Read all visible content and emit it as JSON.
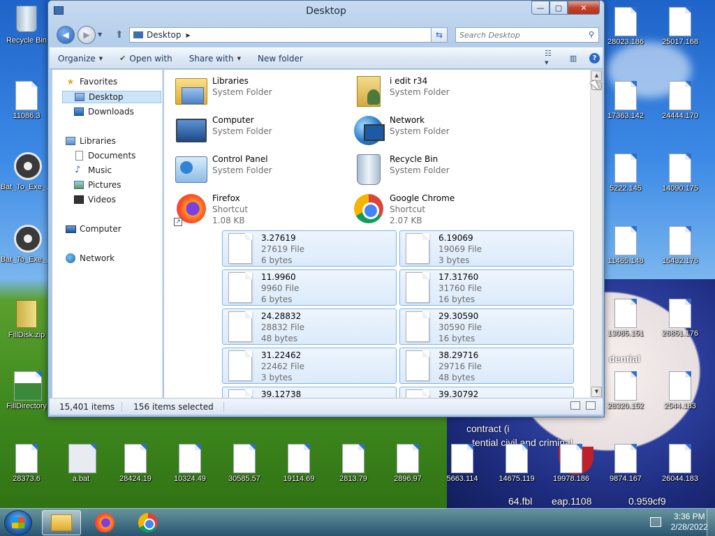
{
  "window": {
    "title": "Desktop",
    "caption_min": "—",
    "caption_max": "▢",
    "caption_close": "✕"
  },
  "navbar": {
    "address": "Desktop",
    "search_placeholder": "Search Desktop"
  },
  "toolbar": {
    "organize": "Organize",
    "open_with": "Open with",
    "share_with": "Share with",
    "new_folder": "New folder"
  },
  "navpane": {
    "favorites": "Favorites",
    "desktop": "Desktop",
    "downloads": "Downloads",
    "libraries": "Libraries",
    "documents": "Documents",
    "music": "Music",
    "pictures": "Pictures",
    "videos": "Videos",
    "computer": "Computer",
    "network": "Network"
  },
  "items": [
    {
      "name": "Libraries",
      "line2": "System Folder",
      "line3": "",
      "icon": "libraries-icon",
      "selected": false
    },
    {
      "name": "i edit r34",
      "line2": "System Folder",
      "line3": "",
      "icon": "user-folder-icon",
      "selected": false
    },
    {
      "name": "Computer",
      "line2": "System Folder",
      "line3": "",
      "icon": "computer-icon",
      "selected": false
    },
    {
      "name": "Network",
      "line2": "System Folder",
      "line3": "",
      "icon": "network-icon",
      "selected": false
    },
    {
      "name": "Control Panel",
      "line2": "System Folder",
      "line3": "",
      "icon": "control-panel-icon",
      "selected": false
    },
    {
      "name": "Recycle Bin",
      "line2": "System Folder",
      "line3": "",
      "icon": "recycle-bin-icon",
      "selected": false
    },
    {
      "name": "Firefox",
      "line2": "Shortcut",
      "line3": "1.08 KB",
      "icon": "firefox-icon",
      "selected": false
    },
    {
      "name": "Google Chrome",
      "line2": "Shortcut",
      "line3": "2.07 KB",
      "icon": "chrome-icon",
      "selected": false
    },
    {
      "name": "3.27619",
      "line2": "27619 File",
      "line3": "6 bytes",
      "icon": "file-icon",
      "selected": true
    },
    {
      "name": "6.19069",
      "line2": "19069 File",
      "line3": "3 bytes",
      "icon": "file-icon",
      "selected": true
    },
    {
      "name": "11.9960",
      "line2": "9960 File",
      "line3": "6 bytes",
      "icon": "file-icon",
      "selected": true
    },
    {
      "name": "17.31760",
      "line2": "31760 File",
      "line3": "16 bytes",
      "icon": "file-icon",
      "selected": true
    },
    {
      "name": "24.28832",
      "line2": "28832 File",
      "line3": "48 bytes",
      "icon": "file-icon",
      "selected": true
    },
    {
      "name": "29.30590",
      "line2": "30590 File",
      "line3": "16 bytes",
      "icon": "file-icon",
      "selected": true
    },
    {
      "name": "31.22462",
      "line2": "22462 File",
      "line3": "3 bytes",
      "icon": "file-icon",
      "selected": true
    },
    {
      "name": "38.29716",
      "line2": "29716 File",
      "line3": "48 bytes",
      "icon": "file-icon",
      "selected": true
    },
    {
      "name": "39.12738",
      "line2": "",
      "line3": "",
      "icon": "file-icon",
      "selected": true
    },
    {
      "name": "39.30792",
      "line2": "",
      "line3": "",
      "icon": "file-icon",
      "selected": true
    }
  ],
  "status": {
    "count": "15,401 items",
    "selected": "156 items selected"
  },
  "desktop_icons": [
    {
      "label": "Recycle Bin",
      "type": "bin"
    },
    {
      "label": "11086.3",
      "type": "doc"
    },
    {
      "label": "Bat_To_Exe_...",
      "type": "gear"
    },
    {
      "label": "Bat_To_Exe_...",
      "type": "gear"
    },
    {
      "label": "FillDisk.zip",
      "type": "zip"
    },
    {
      "label": "FillDirectory",
      "type": "app"
    },
    {
      "label": "28023.186",
      "type": "doc"
    },
    {
      "label": "25017.168",
      "type": "doc"
    },
    {
      "label": "17363.142",
      "type": "doc"
    },
    {
      "label": "24444.170",
      "type": "doc"
    },
    {
      "label": "5222.145",
      "type": "doc"
    },
    {
      "label": "14090.175",
      "type": "doc"
    },
    {
      "label": "11465.148",
      "type": "doc"
    },
    {
      "label": "15432.176",
      "type": "doc"
    },
    {
      "label": "13085.151",
      "type": "doc"
    },
    {
      "label": "26851.176",
      "type": "doc"
    },
    {
      "label": "28320.152",
      "type": "doc"
    },
    {
      "label": "2544.183",
      "type": "doc"
    },
    {
      "label": "28373.6",
      "type": "doc"
    },
    {
      "label": "a.bat",
      "type": "bat"
    },
    {
      "label": "28424.19",
      "type": "doc"
    },
    {
      "label": "10324.49",
      "type": "doc"
    },
    {
      "label": "30585.57",
      "type": "doc"
    },
    {
      "label": "19114.69",
      "type": "doc"
    },
    {
      "label": "2813.79",
      "type": "doc"
    },
    {
      "label": "2896.97",
      "type": "doc"
    },
    {
      "label": "5663.114",
      "type": "doc"
    },
    {
      "label": "14675.119",
      "type": "doc"
    },
    {
      "label": "19978.186",
      "type": "doc"
    },
    {
      "label": "9874.167",
      "type": "doc"
    },
    {
      "label": "26044.183",
      "type": "doc"
    }
  ],
  "wallpaper_text": {
    "line1": "dential",
    "line2": "contract (i",
    "line3": "tential civil and criminal",
    "line4": "64.fbl",
    "line5": "eap.1108",
    "line6": "0.959cf9"
  },
  "taskbar": {
    "time": "3:36 PM",
    "date": "2/28/2022"
  }
}
